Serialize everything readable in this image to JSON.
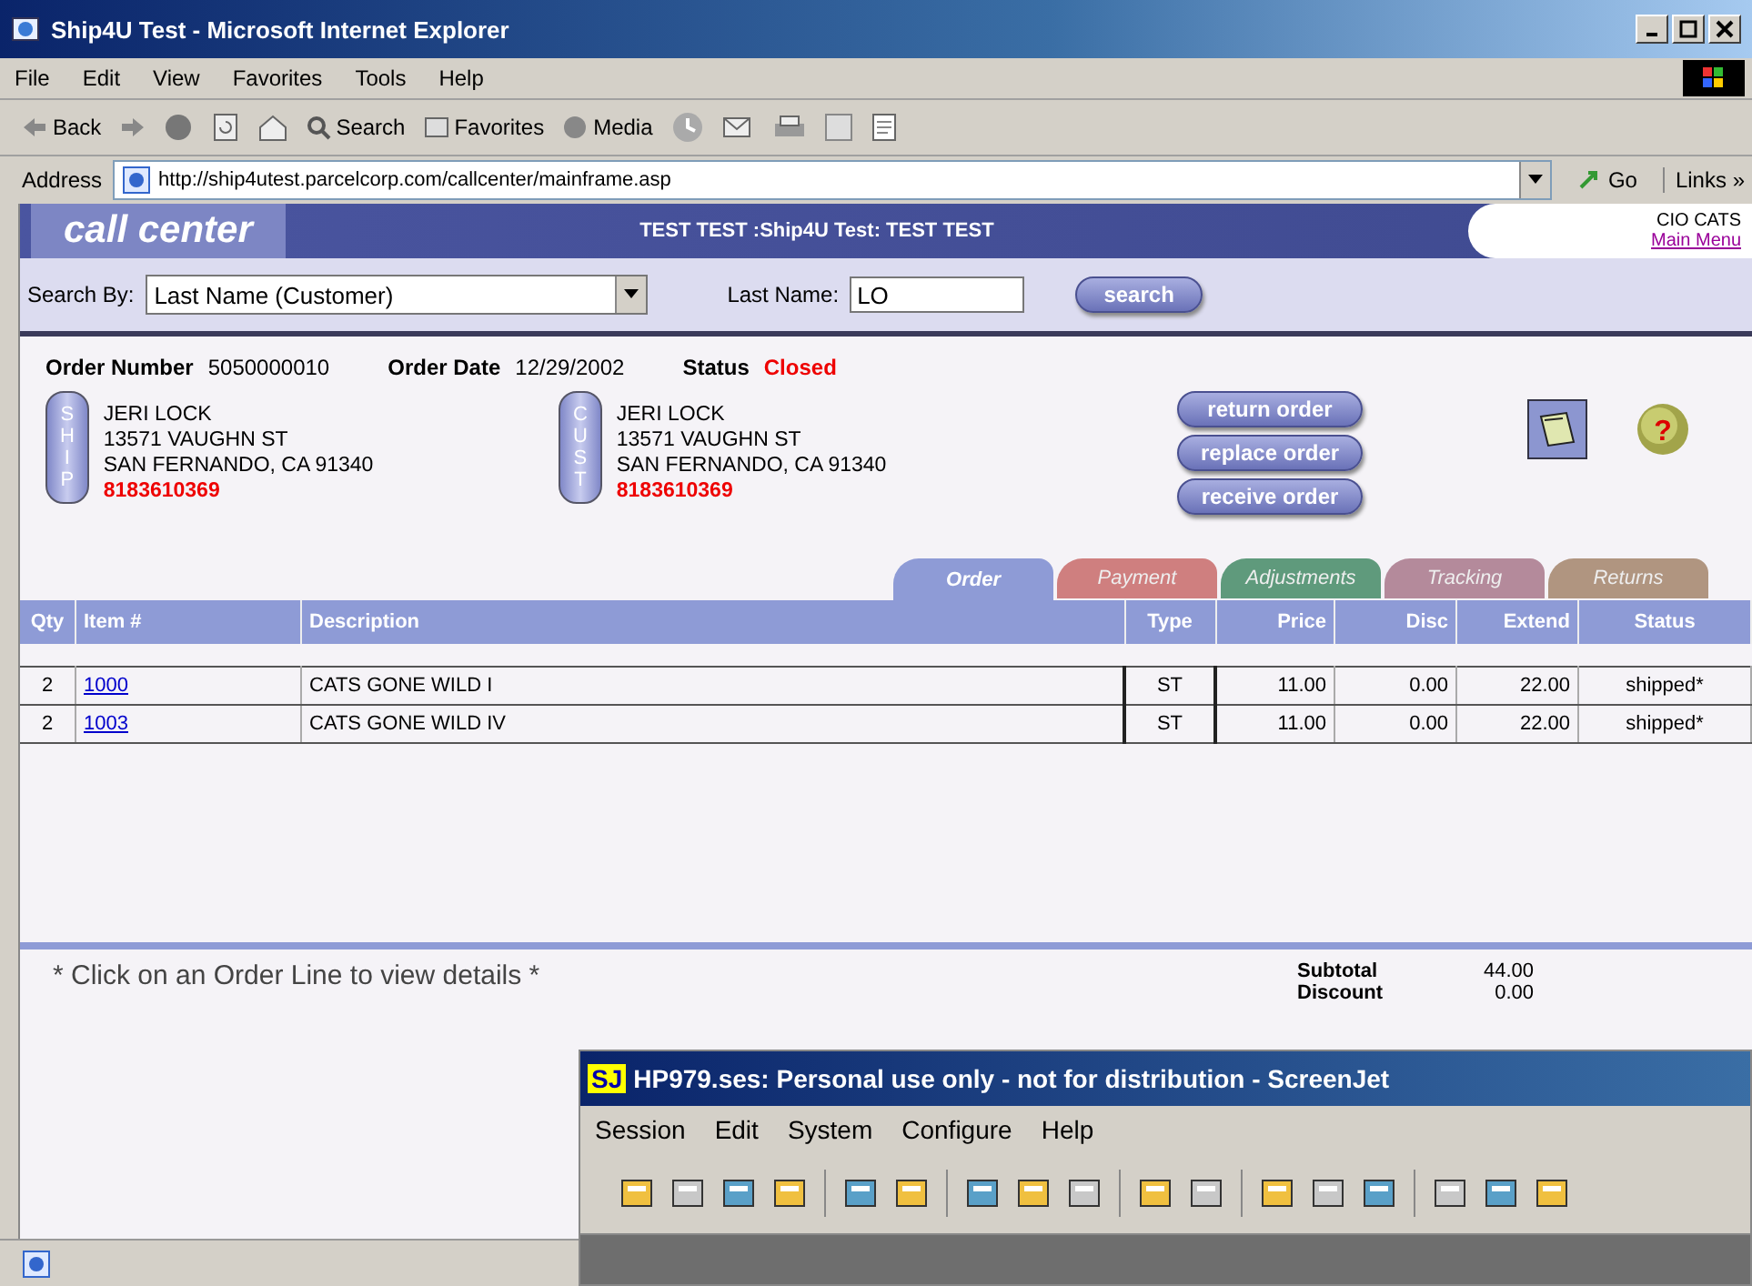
{
  "window": {
    "title": "Ship4U Test - Microsoft Internet Explorer"
  },
  "menu": [
    "File",
    "Edit",
    "View",
    "Favorites",
    "Tools",
    "Help"
  ],
  "toolbar": {
    "back": "Back",
    "search": "Search",
    "favorites": "Favorites",
    "media": "Media"
  },
  "address": {
    "label": "Address",
    "url": "http://ship4utest.parcelcorp.com/callcenter/mainframe.asp",
    "go": "Go",
    "links": "Links »"
  },
  "header": {
    "brand": "call center",
    "title": "TEST TEST :Ship4U Test: TEST TEST",
    "user": "CIO CATS",
    "main_menu": "Main Menu"
  },
  "search": {
    "by_label": "Search By:",
    "by_value": "Last Name (Customer)",
    "field_label": "Last Name:",
    "field_value": "LO",
    "button": "search"
  },
  "order": {
    "number_label": "Order Number",
    "number": "5050000010",
    "date_label": "Order Date",
    "date": "12/29/2002",
    "status_label": "Status",
    "status": "Closed"
  },
  "addresses": [
    {
      "tag": "SHIP",
      "lines": [
        "JERI LOCK",
        "13571 VAUGHN ST",
        "SAN FERNANDO, CA 91340"
      ],
      "phone": "8183610369"
    },
    {
      "tag": "CUST",
      "lines": [
        "JERI LOCK",
        "13571 VAUGHN ST",
        "SAN FERNANDO, CA 91340"
      ],
      "phone": "8183610369"
    }
  ],
  "actions": [
    "return order",
    "replace order",
    "receive order"
  ],
  "help_mark": "?",
  "tabs": [
    {
      "label": "Order",
      "color": "#8e9bd6",
      "selected": true
    },
    {
      "label": "Payment",
      "color": "#cf7f7f",
      "selected": false
    },
    {
      "label": "Adjustments",
      "color": "#5f9a7c",
      "selected": false
    },
    {
      "label": "Tracking",
      "color": "#b48a9b",
      "selected": false
    },
    {
      "label": "Returns",
      "color": "#b09580",
      "selected": false
    }
  ],
  "table": {
    "columns": [
      "Qty",
      "Item #",
      "Description",
      "Type",
      "Price",
      "Disc",
      "Extend",
      "Status"
    ],
    "rows": [
      {
        "qty": "2",
        "item": "1000",
        "description": "CATS GONE WILD I",
        "type": "ST",
        "price": "11.00",
        "disc": "0.00",
        "extend": "22.00",
        "status": "shipped*"
      },
      {
        "qty": "2",
        "item": "1003",
        "description": "CATS GONE WILD IV",
        "type": "ST",
        "price": "11.00",
        "disc": "0.00",
        "extend": "22.00",
        "status": "shipped*"
      }
    ]
  },
  "note": "* Click on an Order Line to view details *",
  "totals": [
    {
      "label": "Subtotal",
      "value": "44.00"
    },
    {
      "label": "Discount",
      "value": "0.00"
    }
  ],
  "screenjet": {
    "logo": "SJ",
    "title": "HP979.ses:  Personal use only - not for distribution - ScreenJet",
    "menu": [
      "Session",
      "Edit",
      "System",
      "Configure",
      "Help"
    ]
  }
}
